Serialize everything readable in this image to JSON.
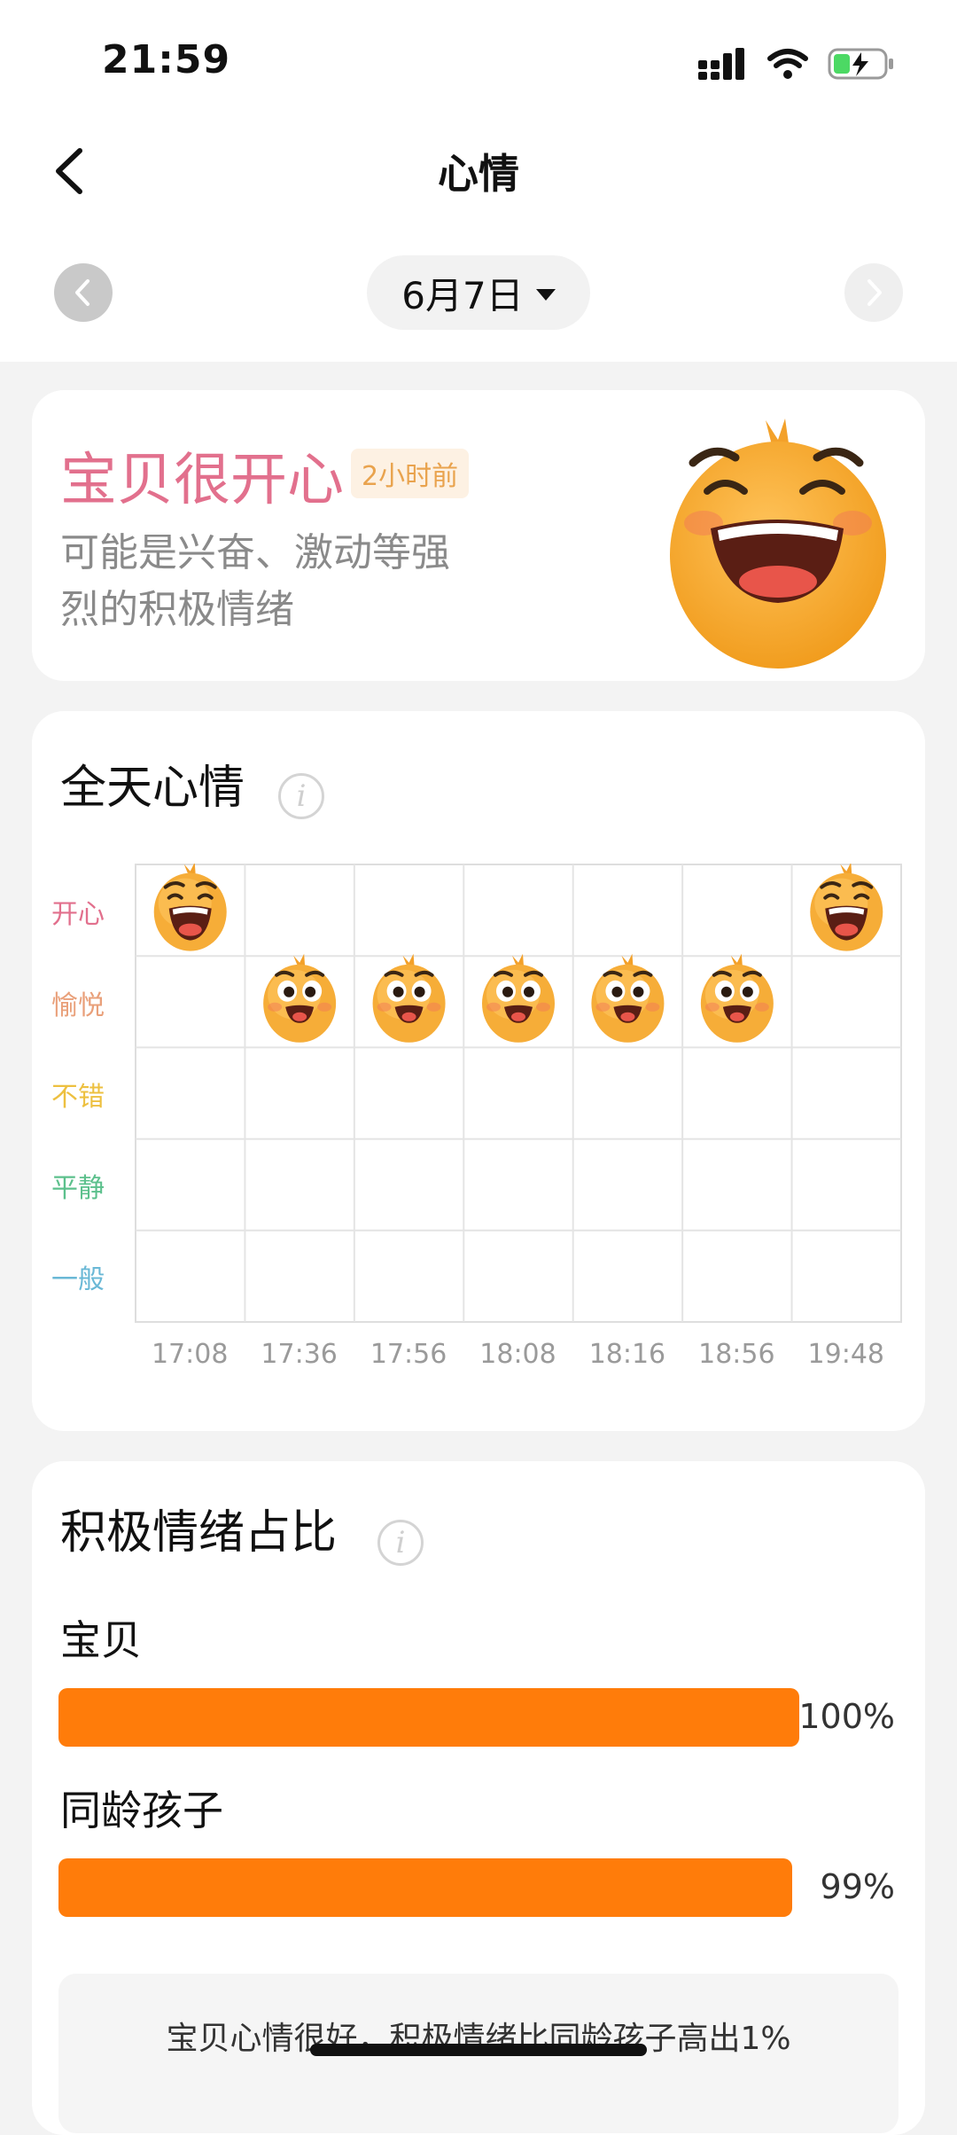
{
  "status": {
    "time": "21:59"
  },
  "nav": {
    "title": "心情"
  },
  "date": {
    "label": "6月7日"
  },
  "mood": {
    "title": "宝贝很开心",
    "time_ago": "2小时前",
    "description": "可能是兴奋、激动等强烈的积极情绪"
  },
  "day_mood": {
    "title": "全天心情",
    "levels": [
      "开心",
      "愉悦",
      "不错",
      "平静",
      "一般"
    ],
    "level_colors": [
      "#e2708d",
      "#e9a07a",
      "#edc040",
      "#5cc08c",
      "#6ab8d6"
    ],
    "times": [
      "17:08",
      "17:36",
      "17:56",
      "18:08",
      "18:16",
      "18:56",
      "19:48"
    ],
    "entries": [
      "开心",
      "愉悦",
      "愉悦",
      "愉悦",
      "愉悦",
      "愉悦",
      "开心"
    ]
  },
  "positive": {
    "title": "积极情绪占比",
    "bars": [
      {
        "label": "宝贝",
        "percent_text": "100%",
        "value": 100
      },
      {
        "label": "同龄孩子",
        "percent_text": "99%",
        "value": 99
      }
    ],
    "summary": "宝贝心情很好，积极情绪比同龄孩子高出1%"
  },
  "colors": {
    "accent": "#ff7c0a",
    "happy": "#e2708d"
  }
}
